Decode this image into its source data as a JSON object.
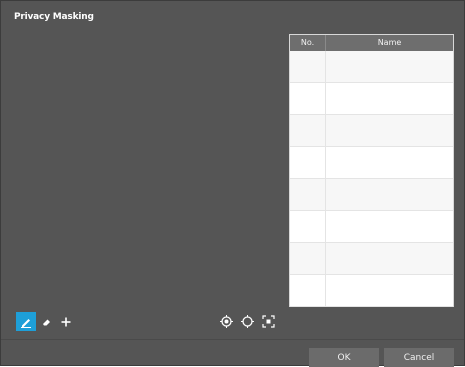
{
  "dialog": {
    "title": "Privacy Masking"
  },
  "mask_table": {
    "columns": [
      "No.",
      "Name"
    ],
    "rows": [
      {
        "no": "",
        "name": ""
      },
      {
        "no": "",
        "name": ""
      },
      {
        "no": "",
        "name": ""
      },
      {
        "no": "",
        "name": ""
      },
      {
        "no": "",
        "name": ""
      },
      {
        "no": "",
        "name": ""
      },
      {
        "no": "",
        "name": ""
      },
      {
        "no": "",
        "name": ""
      }
    ]
  },
  "toolbar": {
    "tools": [
      {
        "name": "draw-mask-tool",
        "icon": "pencil-icon",
        "active": true
      },
      {
        "name": "erase-mask-tool",
        "icon": "eraser-icon",
        "active": false
      },
      {
        "name": "move-mask-tool",
        "icon": "move-cross-icon",
        "active": false
      }
    ],
    "view_controls": [
      {
        "name": "focus-target-button",
        "icon": "target-dot-icon"
      },
      {
        "name": "reset-position-button",
        "icon": "crosshair-circle-icon"
      },
      {
        "name": "fit-screen-button",
        "icon": "fit-screen-icon"
      }
    ]
  },
  "footer": {
    "ok_label": "OK",
    "cancel_label": "Cancel"
  },
  "colors": {
    "background": "#555555",
    "accent": "#1e9fd8",
    "button": "#6b6b6b",
    "table_header": "#6e6e6e"
  }
}
